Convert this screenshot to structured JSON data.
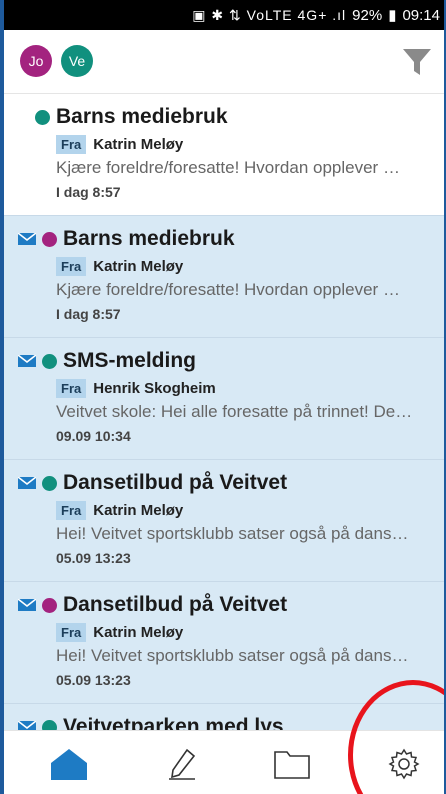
{
  "status_bar": {
    "indicators": "▣ ✱ ⇅ VoLTE 4G+ .ıl",
    "battery": "92%",
    "time": "09:14"
  },
  "header": {
    "avatars": [
      {
        "initials": "Jo",
        "color": "#a3237f"
      },
      {
        "initials": "Ve",
        "color": "#11907e"
      }
    ],
    "filter_icon": "filter-icon"
  },
  "messages": [
    {
      "unread": false,
      "dot_color": "#11907e",
      "subject": "Barns mediebruk",
      "from_label": "Fra",
      "sender": "Katrin Meløy",
      "preview": "Kjære foreldre/foresatte!  Hvordan opplever …",
      "date": "I dag 8:57"
    },
    {
      "unread": true,
      "dot_color": "#a3237f",
      "subject": "Barns mediebruk",
      "from_label": "Fra",
      "sender": "Katrin Meløy",
      "preview": "Kjære foreldre/foresatte!  Hvordan opplever …",
      "date": "I dag 8:57"
    },
    {
      "unread": true,
      "dot_color": "#11907e",
      "subject": "SMS-melding",
      "from_label": "Fra",
      "sender": "Henrik Skogheim",
      "preview": "Veitvet skole: Hei alle foresatte på trinnet! De…",
      "date": "09.09 10:34"
    },
    {
      "unread": true,
      "dot_color": "#11907e",
      "subject": "Dansetilbud på Veitvet",
      "from_label": "Fra",
      "sender": "Katrin Meløy",
      "preview": "Hei! Veitvet sportsklubb satser også på dans…",
      "date": "05.09 13:23"
    },
    {
      "unread": true,
      "dot_color": "#a3237f",
      "subject": "Dansetilbud på Veitvet",
      "from_label": "Fra",
      "sender": "Katrin Meløy",
      "preview": "Hei! Veitvet sportsklubb satser også på dans…",
      "date": "05.09 13:23"
    },
    {
      "unread": true,
      "dot_color": "#11907e",
      "subject": "Veitvetparken med lys",
      "from_label": "",
      "sender": "",
      "preview": "",
      "date": ""
    }
  ],
  "bottom_nav": [
    {
      "icon": "home-icon",
      "active": true
    },
    {
      "icon": "compose-icon",
      "active": false
    },
    {
      "icon": "folder-icon",
      "active": false
    },
    {
      "icon": "settings-icon",
      "active": false
    }
  ],
  "colors": {
    "accent": "#1e7bc4",
    "unread_bg": "#d8e9f5",
    "highlight": "#e8141c"
  }
}
